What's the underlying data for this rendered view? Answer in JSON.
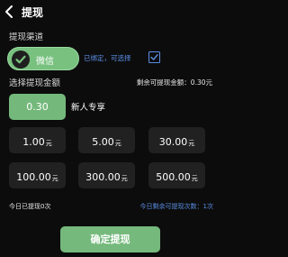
{
  "header": {
    "title": "提现"
  },
  "channel_section": {
    "label": "提现渠道",
    "channel_label": "微信",
    "bound_text": "已绑定，可选择"
  },
  "amount_section": {
    "label": "选择提现金额",
    "remaining_text": "剩余可提现金额：0.30元",
    "special": {
      "value": "0.30",
      "tag": "新人专享"
    },
    "unit": "元",
    "options": [
      "1.00",
      "5.00",
      "30.00",
      "100.00",
      "300.00",
      "500.00"
    ]
  },
  "footer": {
    "today_text": "今日已提现0次",
    "times_text": "今日剩余可提现次数：1次",
    "confirm_label": "确定提现"
  },
  "colors": {
    "accent_green": "#74b97b",
    "link_blue": "#5b8fe6",
    "background": "#0c0c0c",
    "button_dark": "#212121"
  }
}
